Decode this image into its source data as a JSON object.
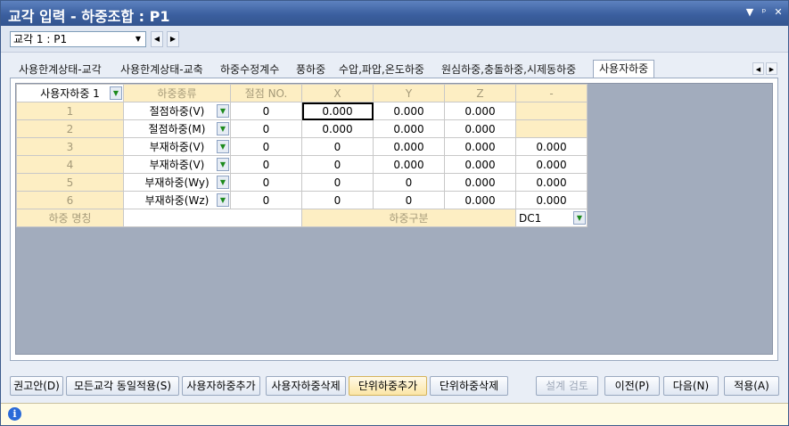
{
  "window": {
    "title": "교각 입력 - 하중조합 : P1",
    "controls": [
      "▼",
      "ᵖ",
      "✕"
    ]
  },
  "pier_selector": {
    "value": "교각 1 : P1",
    "prev": "◀",
    "next": "▶"
  },
  "tabs": [
    {
      "label": "사용한계상태-교각"
    },
    {
      "label": "사용한계상태-교축"
    },
    {
      "label": "하중수정계수"
    },
    {
      "label": "풍하중"
    },
    {
      "label": "수압,파압,온도하중"
    },
    {
      "label": "원심하중,충돌하중,시제동하중"
    },
    {
      "label": "사용자하중",
      "active": true
    }
  ],
  "tab_scroll": {
    "left": "◀",
    "right": "▶"
  },
  "grid": {
    "selector": "사용자하중 1",
    "headers": [
      "하중종류",
      "절점 NO.",
      "X",
      "Y",
      "Z",
      "-"
    ],
    "rows": [
      {
        "no": "1",
        "type": "절점하중(V)",
        "node": "0",
        "x": "0.000",
        "y": "0.000",
        "z": "0.000",
        "extra": ""
      },
      {
        "no": "2",
        "type": "절점하중(M)",
        "node": "0",
        "x": "0.000",
        "y": "0.000",
        "z": "0.000",
        "extra": ""
      },
      {
        "no": "3",
        "type": "부재하중(V)",
        "node": "0",
        "x": "0",
        "y": "0.000",
        "z": "0.000",
        "extra": "0.000"
      },
      {
        "no": "4",
        "type": "부재하중(V)",
        "node": "0",
        "x": "0",
        "y": "0.000",
        "z": "0.000",
        "extra": "0.000"
      },
      {
        "no": "5",
        "type": "부재하중(Wy)",
        "node": "0",
        "x": "0",
        "y": "0",
        "z": "0.000",
        "extra": "0.000"
      },
      {
        "no": "6",
        "type": "부재하중(Wz)",
        "node": "0",
        "x": "0",
        "y": "0",
        "z": "0.000",
        "extra": "0.000"
      }
    ],
    "footer": {
      "name_label": "하중 명칭",
      "name_value": "",
      "class_label": "하중구분",
      "class_value": "DC1"
    }
  },
  "buttons": {
    "recommend": "권고안(D)",
    "apply_all": "모든교각 동일적용(S)",
    "add_user_load": "사용자하중추가",
    "del_user_load": "사용자하중삭제",
    "add_unit_load": "단위하중추가",
    "del_unit_load": "단위하중삭제",
    "design_check": "설계 검토",
    "prev": "이전(P)",
    "next": "다음(N)",
    "apply": "적용(A)"
  },
  "status": {
    "icon": "info-icon",
    "text": ""
  },
  "colors": {
    "title": "#3b5f9f",
    "header": "#fdeec3",
    "grid_bg": "#a2acbd"
  }
}
